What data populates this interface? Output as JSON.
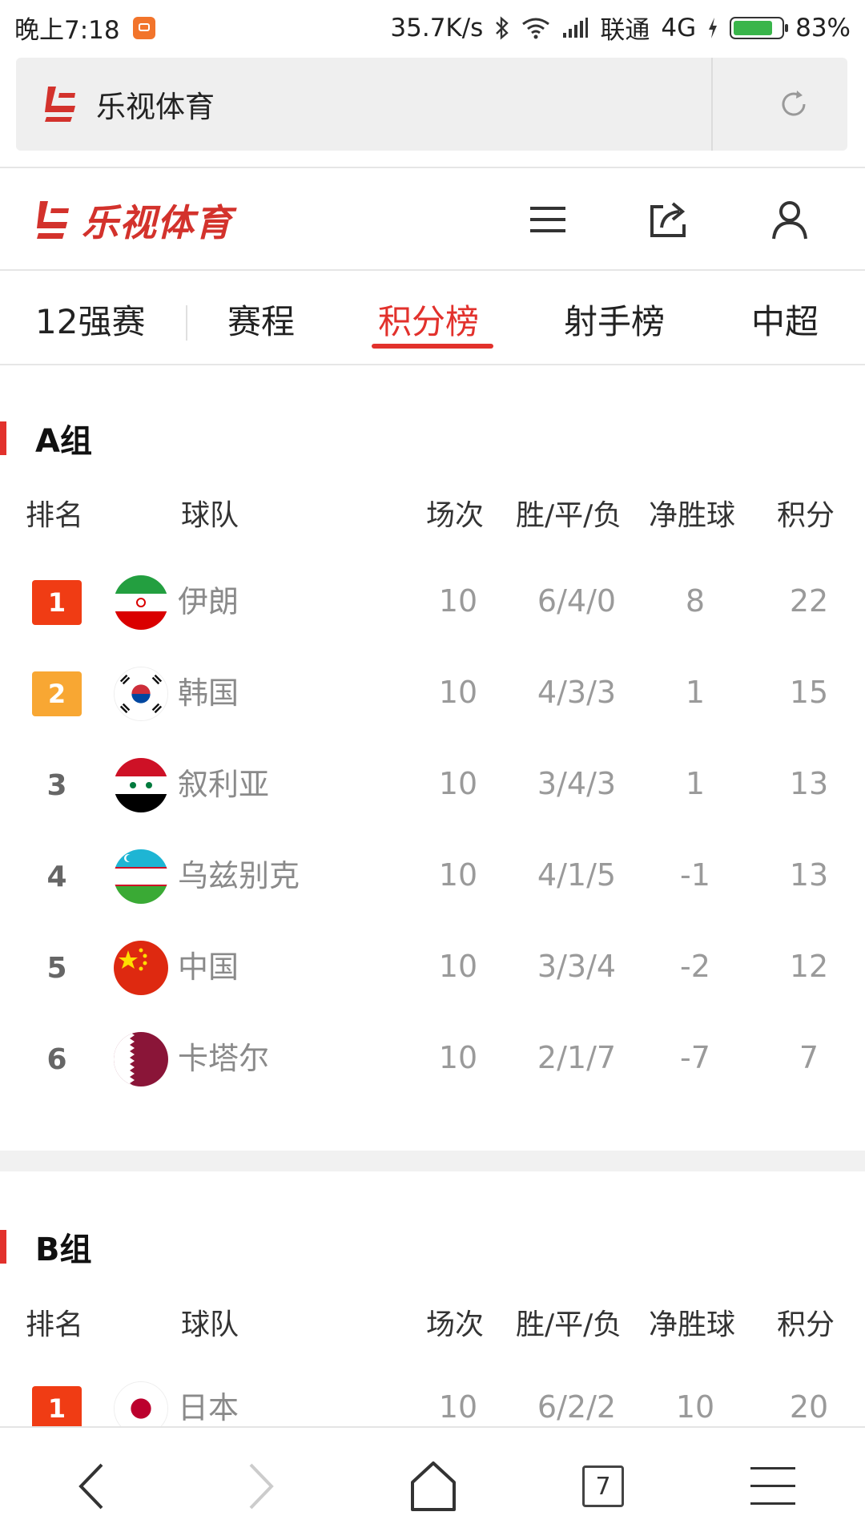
{
  "status_bar": {
    "time": "晚上7:18",
    "speed": "35.7K/s",
    "carrier": "联通",
    "network": "4G",
    "battery_percent": "83%",
    "battery_level": 0.83
  },
  "browser": {
    "page_title": "乐视体育",
    "tab_count": "7"
  },
  "site": {
    "brand": "乐视体育",
    "brand_color": "#d3322c"
  },
  "tabs": [
    {
      "label": "12强赛"
    },
    {
      "label": "赛程"
    },
    {
      "label": "积分榜",
      "active": true
    },
    {
      "label": "射手榜"
    },
    {
      "label": "中超"
    }
  ],
  "columns": {
    "rank": "排名",
    "team": "球队",
    "games": "场次",
    "wdl": "胜/平/负",
    "goal_diff": "净胜球",
    "points": "积分"
  },
  "groups": [
    {
      "name": "A组",
      "rows": [
        {
          "rank": "1",
          "team": "伊朗",
          "flag": "iran",
          "games": "10",
          "wdl": "6/4/0",
          "gd": "8",
          "pts": "22"
        },
        {
          "rank": "2",
          "team": "韩国",
          "flag": "korea",
          "games": "10",
          "wdl": "4/3/3",
          "gd": "1",
          "pts": "15"
        },
        {
          "rank": "3",
          "team": "叙利亚",
          "flag": "syria",
          "games": "10",
          "wdl": "3/4/3",
          "gd": "1",
          "pts": "13"
        },
        {
          "rank": "4",
          "team": "乌兹别克",
          "flag": "uzbekistan",
          "games": "10",
          "wdl": "4/1/5",
          "gd": "-1",
          "pts": "13"
        },
        {
          "rank": "5",
          "team": "中国",
          "flag": "china",
          "games": "10",
          "wdl": "3/3/4",
          "gd": "-2",
          "pts": "12"
        },
        {
          "rank": "6",
          "team": "卡塔尔",
          "flag": "qatar",
          "games": "10",
          "wdl": "2/1/7",
          "gd": "-7",
          "pts": "7"
        }
      ]
    },
    {
      "name": "B组",
      "rows": [
        {
          "rank": "1",
          "team": "日本",
          "flag": "japan",
          "games": "10",
          "wdl": "6/2/2",
          "gd": "10",
          "pts": "20"
        }
      ]
    }
  ],
  "colors": {
    "accent": "#e2312c",
    "rank1": "#f03c14",
    "rank2": "#f8a733"
  }
}
